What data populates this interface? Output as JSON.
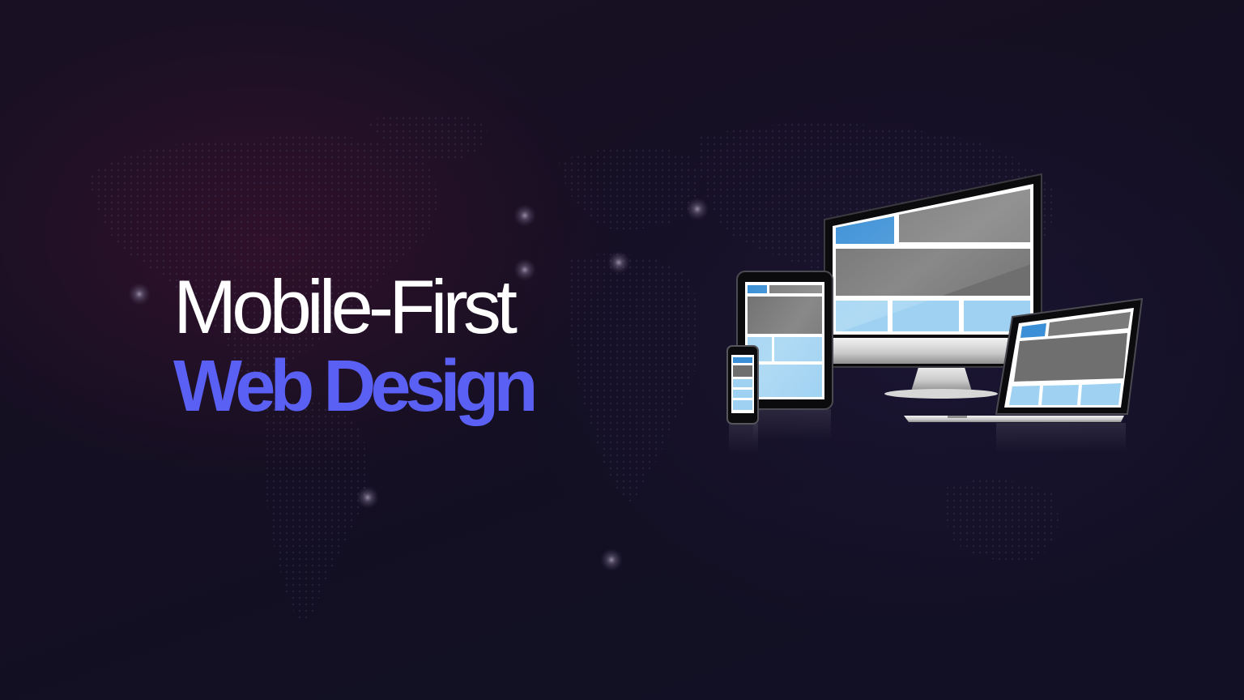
{
  "headline": {
    "line1": "Mobile-First",
    "line2": "Web Design"
  },
  "colors": {
    "background": "#140f22",
    "accent": "#5b60f5",
    "headline_white": "#ffffff",
    "screen_blue": "#3a8fd6",
    "screen_light_blue": "#9fd2f2",
    "screen_gray": "#7a7a7a"
  },
  "illustration": {
    "devices": [
      "desktop-monitor",
      "tablet",
      "smartphone",
      "laptop"
    ]
  }
}
